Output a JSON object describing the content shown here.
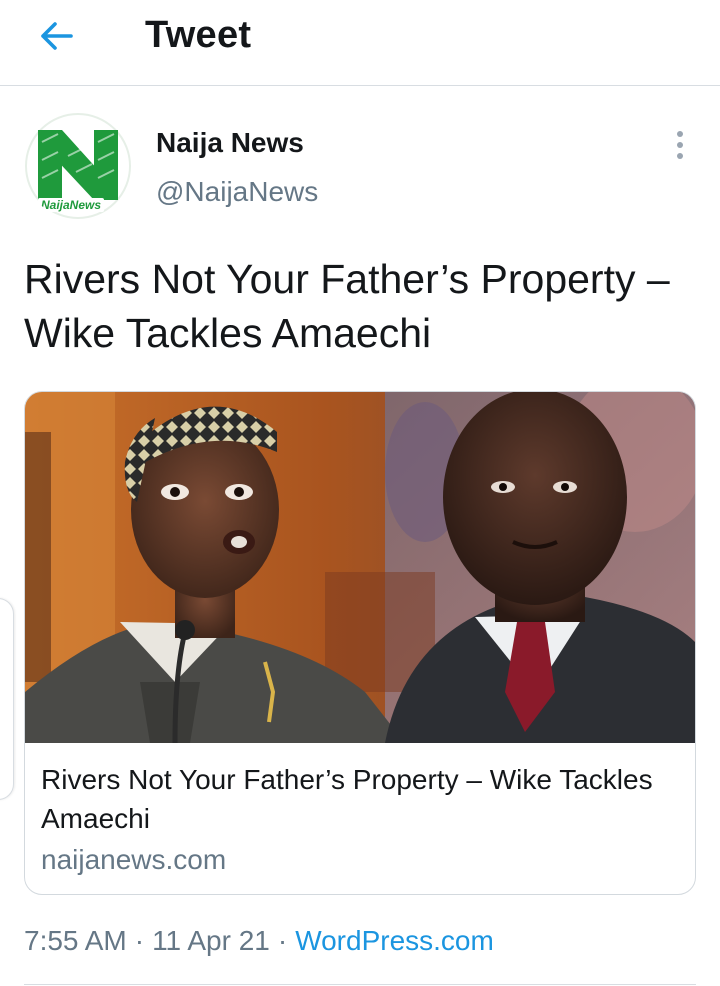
{
  "header": {
    "title": "Tweet",
    "back_icon": "arrow-left-icon"
  },
  "tweet": {
    "author": {
      "name": "Naija News",
      "handle": "@NaijaNews",
      "avatar_logo_text": "NaijaNews"
    },
    "text": "Rivers Not Your Father’s Property – Wike Tackles Amaechi",
    "card": {
      "title": "Rivers Not Your Father’s Property – Wike Tackles Amaechi",
      "domain": "naijanews.com",
      "image_description": "photo of two men"
    },
    "time": "7:55 AM",
    "date": "11 Apr 21",
    "source": "WordPress.com",
    "separator": "·"
  },
  "colors": {
    "accent": "#1b95e0",
    "secondary_text": "#657786",
    "primary_text": "#14171a",
    "logo_green": "#1f9a3c",
    "border": "#d8dde2"
  }
}
